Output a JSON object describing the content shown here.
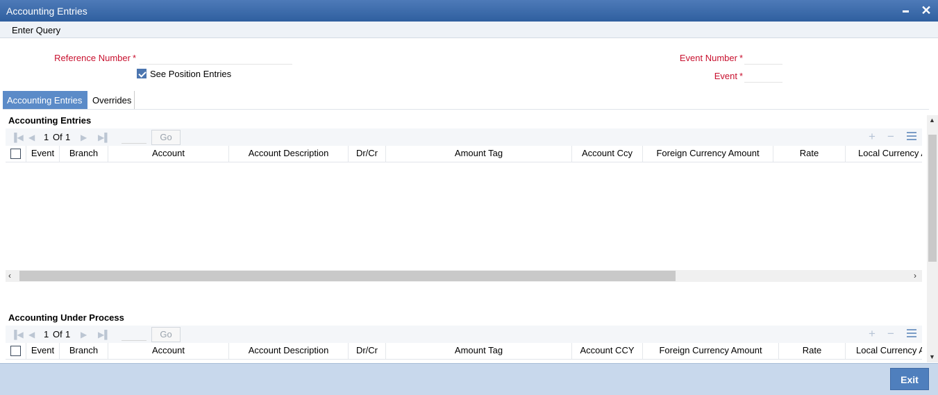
{
  "window": {
    "title": "Accounting Entries",
    "minimize_glyph": "▬",
    "close_glyph": "✕"
  },
  "menu": {
    "enter_query": "Enter Query"
  },
  "form": {
    "reference_number_label": "Reference Number",
    "reference_number_value": "",
    "see_position_entries_label": "See Position Entries",
    "see_position_entries_checked": true,
    "event_number_label": "Event Number",
    "event_number_value": "",
    "event_label": "Event",
    "event_value": "",
    "required_mark": "*"
  },
  "tabs": [
    {
      "label": "Accounting Entries",
      "active": true
    },
    {
      "label": "Overrides",
      "active": false
    }
  ],
  "accounting_entries": {
    "title": "Accounting Entries",
    "pager": {
      "current": "1",
      "of_label": "Of",
      "total": "1",
      "go_label": "Go"
    },
    "columns": [
      "Event",
      "Branch",
      "Account",
      "Account Description",
      "Dr/Cr",
      "Amount Tag",
      "Account Ccy",
      "Foreign Currency Amount",
      "Rate",
      "Local Currency Amount"
    ],
    "rows": []
  },
  "accounting_under_process": {
    "title": "Accounting Under Process",
    "pager": {
      "current": "1",
      "of_label": "Of",
      "total": "1",
      "go_label": "Go"
    },
    "columns": [
      "Event",
      "Branch",
      "Account",
      "Account Description",
      "Dr/Cr",
      "Amount Tag",
      "Account CCY",
      "Foreign Currency Amount",
      "Rate",
      "Local Currency Amount"
    ],
    "rows": []
  },
  "footer": {
    "exit_label": "Exit"
  },
  "colors": {
    "title_bar": "#2f5f9f",
    "accent": "#5b8bc8",
    "required": "#c8102e",
    "footer": "#c8d8ec"
  }
}
